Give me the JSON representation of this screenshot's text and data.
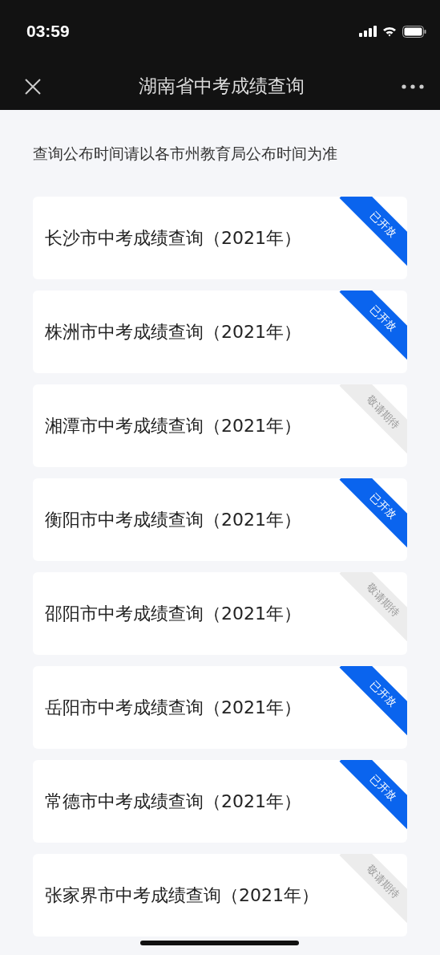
{
  "status_bar": {
    "time": "03:59"
  },
  "nav": {
    "title": "湖南省中考成绩查询"
  },
  "notice": "查询公布时间请以各市州教育局公布时间为准",
  "cities": [
    {
      "title": "长沙市中考成绩查询（2021年）",
      "open": true,
      "badge": "已开放"
    },
    {
      "title": "株洲市中考成绩查询（2021年）",
      "open": true,
      "badge": "已开放"
    },
    {
      "title": "湘潭市中考成绩查询（2021年）",
      "open": false,
      "badge": "敬请期待"
    },
    {
      "title": "衡阳市中考成绩查询（2021年）",
      "open": true,
      "badge": "已开放"
    },
    {
      "title": "邵阳市中考成绩查询（2021年）",
      "open": false,
      "badge": "敬请期待"
    },
    {
      "title": "岳阳市中考成绩查询（2021年）",
      "open": true,
      "badge": "已开放"
    },
    {
      "title": "常德市中考成绩查询（2021年）",
      "open": true,
      "badge": "已开放"
    },
    {
      "title": "张家界市中考成绩查询（2021年）",
      "open": false,
      "badge": "敬请期待"
    }
  ]
}
